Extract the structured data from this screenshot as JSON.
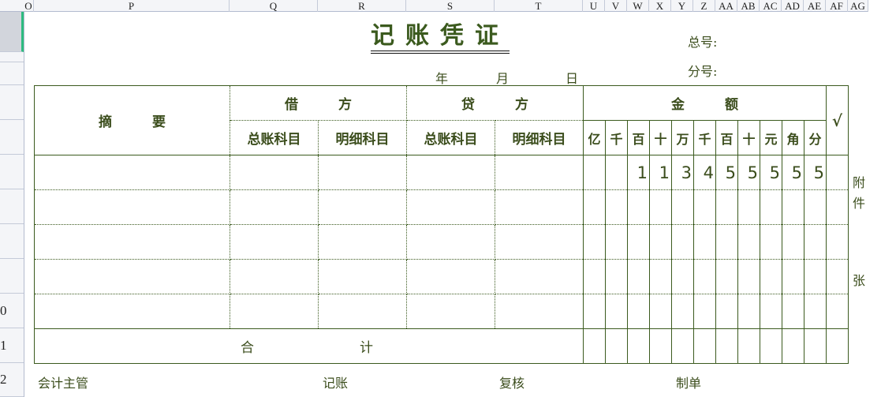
{
  "columns": [
    "O",
    "P",
    "Q",
    "R",
    "S",
    "T",
    "U",
    "V",
    "W",
    "X",
    "Y",
    "Z",
    "AA",
    "AB",
    "AC",
    "AD",
    "AE",
    "AF",
    "AG"
  ],
  "rows": [
    "",
    "",
    "",
    "",
    "",
    "",
    "",
    "",
    "",
    "0",
    "1",
    "2"
  ],
  "title": "记账凭证",
  "total_no": "总号:",
  "sub_no": "分号:",
  "date": {
    "year": "年",
    "month": "月",
    "day": "日"
  },
  "header": {
    "summary": "摘　　　要",
    "debit": "借　　　方",
    "credit": "贷　　　方",
    "amount": "金　　　额",
    "check": "√",
    "gl": "总账科目",
    "detail": "明细科目",
    "units": [
      "亿",
      "千",
      "百",
      "十",
      "万",
      "千",
      "百",
      "十",
      "元",
      "角",
      "分"
    ]
  },
  "entries": [
    {
      "digits": [
        "",
        "",
        "1",
        "1",
        "3",
        "4",
        "5",
        "5",
        "5",
        "5",
        "5"
      ]
    },
    {
      "digits": []
    },
    {
      "digits": []
    },
    {
      "digits": []
    },
    {
      "digits": []
    }
  ],
  "total_label": {
    "a": "合",
    "b": "计"
  },
  "attachment": {
    "a": "附",
    "b": "件",
    "c": "张"
  },
  "footer": {
    "supervisor": "会计主管",
    "bookkeeper": "记账",
    "reviewer": "复核",
    "preparer": "制单"
  }
}
